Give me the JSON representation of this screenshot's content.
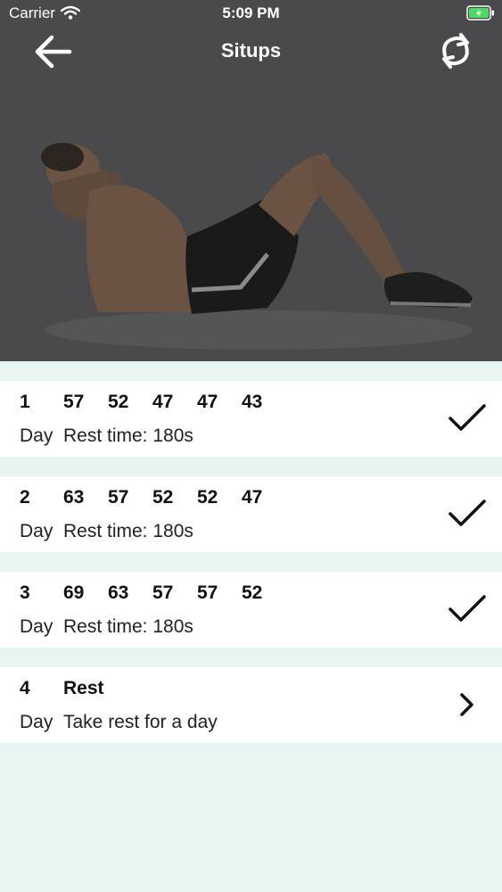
{
  "status_bar": {
    "carrier": "Carrier",
    "time": "5:09 PM",
    "battery_color": "#4cd964"
  },
  "header": {
    "title": "Situps",
    "back_icon": "arrow-left-icon",
    "refresh_icon": "refresh-icon"
  },
  "plan": [
    {
      "day": "1",
      "reps": [
        "57",
        "52",
        "47",
        "47",
        "43"
      ],
      "day_label": "Day",
      "note": "Rest time: 180s",
      "status_icon": "checkmark-icon"
    },
    {
      "day": "2",
      "reps": [
        "63",
        "57",
        "52",
        "52",
        "47"
      ],
      "day_label": "Day",
      "note": "Rest time: 180s",
      "status_icon": "checkmark-icon"
    },
    {
      "day": "3",
      "reps": [
        "69",
        "63",
        "57",
        "57",
        "52"
      ],
      "day_label": "Day",
      "note": "Rest time: 180s",
      "status_icon": "checkmark-icon"
    },
    {
      "day": "4",
      "title": "Rest",
      "day_label": "Day",
      "note": "Take rest for a day",
      "status_icon": "chevron-right-icon"
    }
  ],
  "colors": {
    "hero_bg": "#4a4a4c",
    "page_bg": "#e8f4f1",
    "row_bg": "#ffffff"
  }
}
